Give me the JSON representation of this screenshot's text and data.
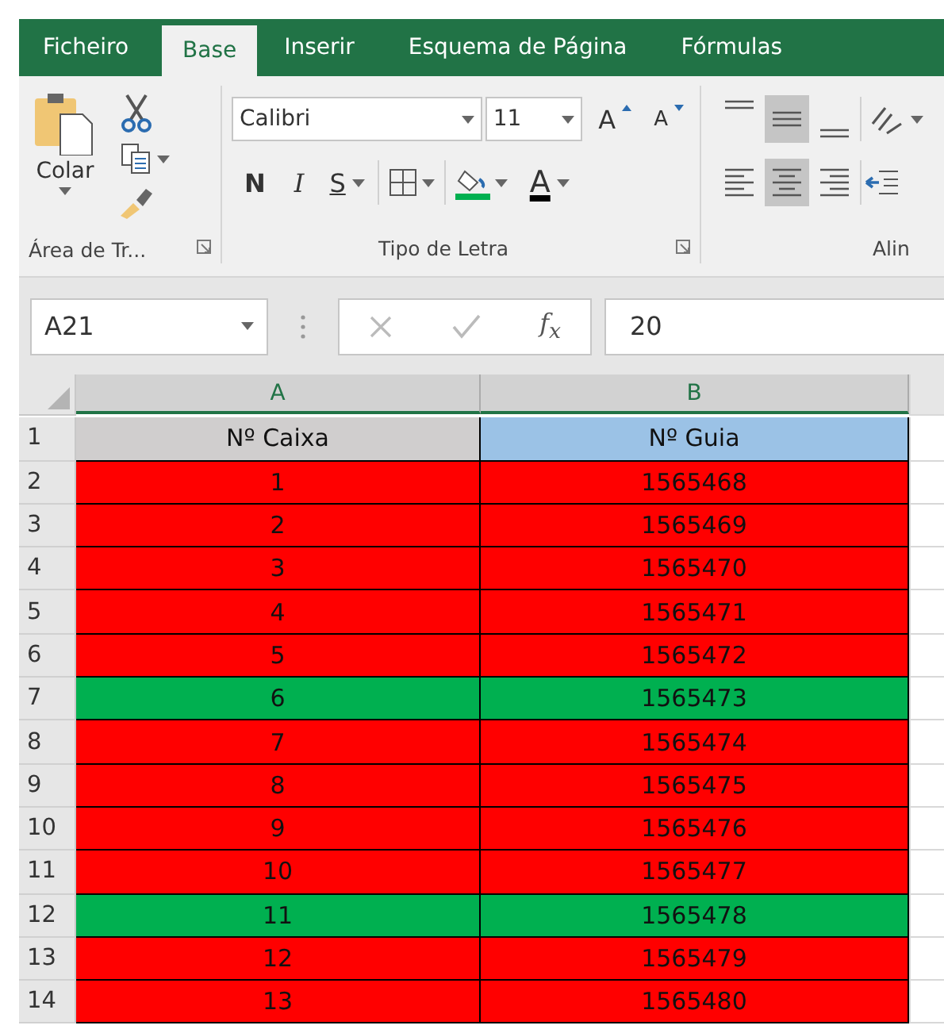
{
  "tabs": [
    {
      "label": "Ficheiro",
      "selected": false
    },
    {
      "label": "Base",
      "selected": true
    },
    {
      "label": "Inserir",
      "selected": false
    },
    {
      "label": "Esquema de Página",
      "selected": false
    },
    {
      "label": "Fórmulas",
      "selected": false
    }
  ],
  "clipboard": {
    "paste_label": "Colar",
    "group_label": "Área de Tr..."
  },
  "font": {
    "name": "Calibri",
    "size": "11",
    "grow": "A",
    "shrink": "A",
    "bold": "N",
    "italic": "I",
    "underline": "S",
    "font_color_letter": "A",
    "group_label": "Tipo de Letra"
  },
  "alignment": {
    "vertical": [
      {
        "kind": "top",
        "selected": false
      },
      {
        "kind": "middle",
        "selected": true
      },
      {
        "kind": "bottom",
        "selected": false
      }
    ],
    "horizontal": [
      {
        "kind": "left",
        "selected": false
      },
      {
        "kind": "center",
        "selected": true
      },
      {
        "kind": "right",
        "selected": false
      }
    ],
    "group_label": "Alin"
  },
  "formula_bar": {
    "name_box": "A21",
    "function_label": "f$_{x}$",
    "value": "20"
  },
  "columns": [
    "A",
    "B"
  ],
  "header_row": {
    "number": "1",
    "cells": [
      {
        "text": "Nº Caixa",
        "color": "#d0cece"
      },
      {
        "text": "Nº Guia",
        "color": "#9bc2e6"
      }
    ]
  },
  "rows": [
    {
      "number": "2",
      "color": "#ff0000",
      "cells": [
        "1",
        "1565468"
      ]
    },
    {
      "number": "3",
      "color": "#ff0000",
      "cells": [
        "2",
        "1565469"
      ]
    },
    {
      "number": "4",
      "color": "#ff0000",
      "cells": [
        "3",
        "1565470"
      ]
    },
    {
      "number": "5",
      "color": "#ff0000",
      "cells": [
        "4",
        "1565471"
      ]
    },
    {
      "number": "6",
      "color": "#ff0000",
      "cells": [
        "5",
        "1565472"
      ]
    },
    {
      "number": "7",
      "color": "#00b050",
      "cells": [
        "6",
        "1565473"
      ]
    },
    {
      "number": "8",
      "color": "#ff0000",
      "cells": [
        "7",
        "1565474"
      ]
    },
    {
      "number": "9",
      "color": "#ff0000",
      "cells": [
        "8",
        "1565475"
      ]
    },
    {
      "number": "10",
      "color": "#ff0000",
      "cells": [
        "9",
        "1565476"
      ]
    },
    {
      "number": "11",
      "color": "#ff0000",
      "cells": [
        "10",
        "1565477"
      ]
    },
    {
      "number": "12",
      "color": "#00b050",
      "cells": [
        "11",
        "1565478"
      ]
    },
    {
      "number": "13",
      "color": "#ff0000",
      "cells": [
        "12",
        "1565479"
      ]
    },
    {
      "number": "14",
      "color": "#ff0000",
      "cells": [
        "13",
        "1565480"
      ]
    }
  ]
}
